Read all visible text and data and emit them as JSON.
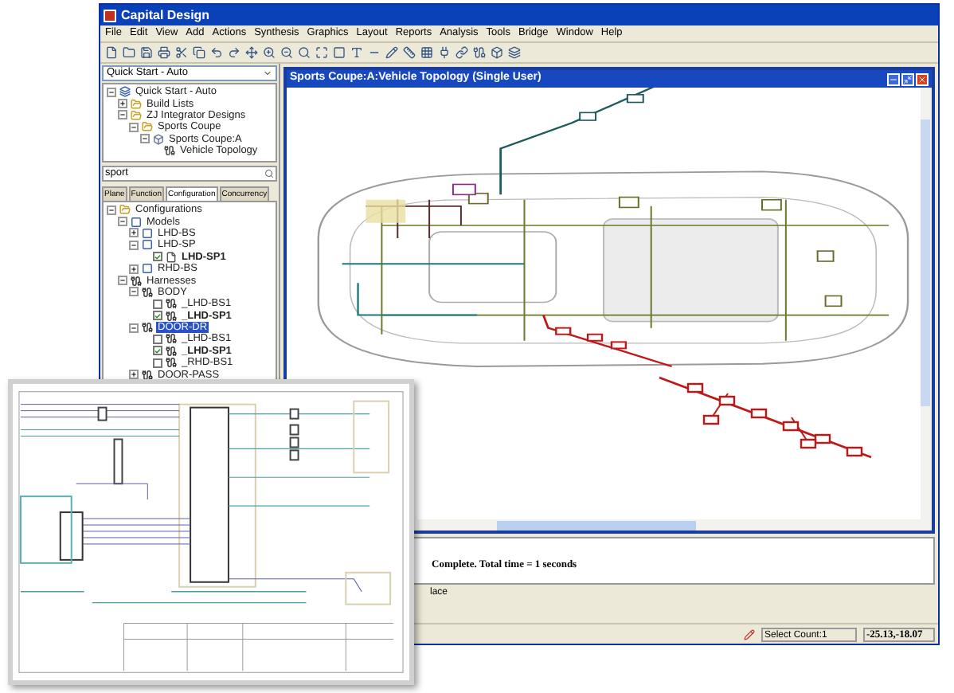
{
  "window": {
    "title": "Capital Design"
  },
  "menu": [
    "File",
    "Edit",
    "View",
    "Add",
    "Actions",
    "Synthesis",
    "Graphics",
    "Layout",
    "Reports",
    "Analysis",
    "Tools",
    "Bridge",
    "Window",
    "Help"
  ],
  "project_selector": {
    "value": "Quick Start - Auto"
  },
  "project_tree": [
    {
      "label": "Quick Start - Auto",
      "kind": "project",
      "expanded": true,
      "selected": false,
      "children": [
        {
          "label": "Build Lists",
          "kind": "folder",
          "expanded": false,
          "selected": false
        },
        {
          "label": "ZJ Integrator Designs",
          "kind": "folder",
          "expanded": true,
          "selected": false,
          "children": [
            {
              "label": "Sports Coupe",
              "kind": "folder",
              "expanded": true,
              "selected": false,
              "children": [
                {
                  "label": "Sports Coupe:A",
                  "kind": "design",
                  "expanded": true,
                  "selected": false,
                  "children": [
                    {
                      "label": "Vehicle Topology",
                      "kind": "topology",
                      "selected": false
                    }
                  ]
                }
              ]
            }
          ]
        }
      ]
    }
  ],
  "search": {
    "value": "sport"
  },
  "tabs": [
    {
      "label": "Plane",
      "selected": false
    },
    {
      "label": "Function",
      "selected": false
    },
    {
      "label": "Configuration",
      "selected": true
    },
    {
      "label": "Concurrency",
      "selected": false
    }
  ],
  "config_tree": [
    {
      "label": "Configurations",
      "kind": "folder",
      "expanded": true,
      "selected": false,
      "children": [
        {
          "label": "Models",
          "kind": "model",
          "expanded": true,
          "selected": false,
          "children": [
            {
              "label": "LHD-BS",
              "kind": "model",
              "expanded": false,
              "selected": false
            },
            {
              "label": "LHD-SP",
              "kind": "model",
              "expanded": true,
              "selected": false,
              "children": [
                {
                  "label": "LHD-SP1",
                  "kind": "config",
                  "checked": true,
                  "selected": false
                }
              ]
            },
            {
              "label": "RHD-BS",
              "kind": "model",
              "expanded": false,
              "selected": false
            }
          ]
        },
        {
          "label": "Harnesses",
          "kind": "harness",
          "expanded": true,
          "selected": false,
          "children": [
            {
              "label": "BODY",
              "kind": "harness",
              "expanded": true,
              "selected": false,
              "children": [
                {
                  "label": "_LHD-BS1",
                  "kind": "harness",
                  "checked": false,
                  "selected": false
                },
                {
                  "label": "_LHD-SP1",
                  "kind": "harness",
                  "checked": true,
                  "selected": false
                }
              ]
            },
            {
              "label": "DOOR-DR",
              "kind": "harness",
              "expanded": true,
              "selected": true,
              "children": [
                {
                  "label": "_LHD-BS1",
                  "kind": "harness",
                  "checked": false,
                  "selected": false
                },
                {
                  "label": "_LHD-SP1",
                  "kind": "harness",
                  "checked": true,
                  "selected": false
                },
                {
                  "label": "_RHD-BS1",
                  "kind": "harness",
                  "checked": false,
                  "selected": false
                }
              ]
            },
            {
              "label": "DOOR-PASS",
              "kind": "harness",
              "expanded": false,
              "selected": false
            }
          ]
        }
      ]
    }
  ],
  "document_window": {
    "title": "Sports Coupe:A:Vehicle Topology (Single User)"
  },
  "output": {
    "message": "Complete. Total time = 1 seconds"
  },
  "output_tabs": [
    {
      "label": "lace"
    }
  ],
  "status_bar": {
    "select_count": "Select Count:1",
    "coordinates": "-25.13,-18.07"
  }
}
